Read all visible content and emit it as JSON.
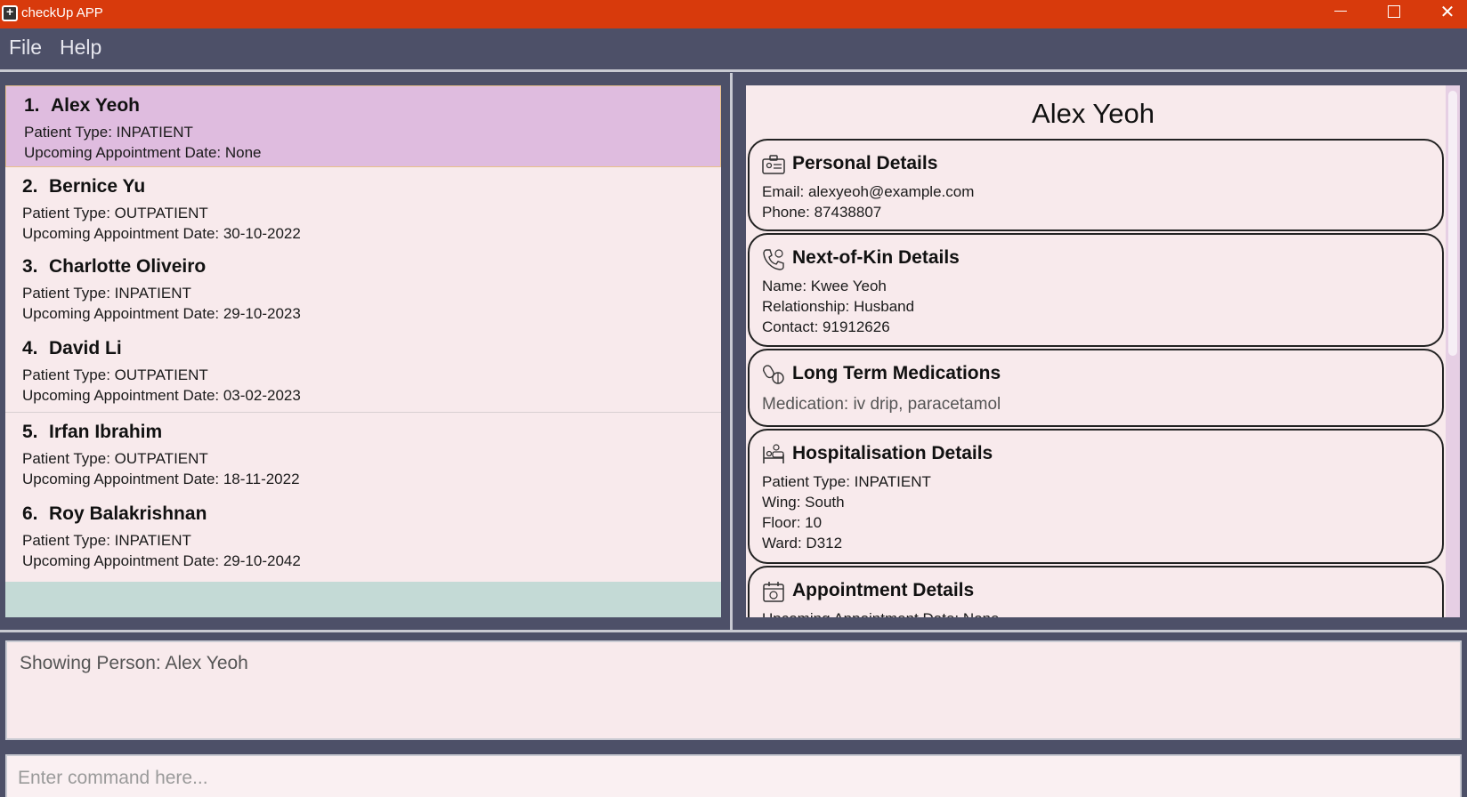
{
  "window": {
    "title": "checkUp APP",
    "minimize_icon": "minimize-icon",
    "maximize_icon": "maximize-icon",
    "close_icon": "close-icon",
    "close_glyph": "✕"
  },
  "menu": {
    "file": "File",
    "help": "Help"
  },
  "patients": [
    {
      "index": "1.",
      "name": "Alex Yeoh",
      "type": "Patient Type: INPATIENT",
      "appointment": "Upcoming Appointment Date: None"
    },
    {
      "index": "2.",
      "name": "Bernice Yu",
      "type": "Patient Type: OUTPATIENT",
      "appointment": "Upcoming Appointment Date: 30-10-2022"
    },
    {
      "index": "3.",
      "name": "Charlotte Oliveiro",
      "type": "Patient Type: INPATIENT",
      "appointment": "Upcoming Appointment Date: 29-10-2023"
    },
    {
      "index": "4.",
      "name": "David Li",
      "type": "Patient Type: OUTPATIENT",
      "appointment": "Upcoming Appointment Date: 03-02-2023"
    },
    {
      "index": "5.",
      "name": "Irfan Ibrahim",
      "type": "Patient Type: OUTPATIENT",
      "appointment": "Upcoming Appointment Date: 18-11-2022"
    },
    {
      "index": "6.",
      "name": "Roy Balakrishnan",
      "type": "Patient Type: INPATIENT",
      "appointment": "Upcoming Appointment Date: 29-10-2042"
    }
  ],
  "detail": {
    "name": "Alex Yeoh",
    "personal": {
      "title": "Personal Details",
      "email": "Email: alexyeoh@example.com",
      "phone": "Phone: 87438807"
    },
    "next_of_kin": {
      "title": "Next-of-Kin Details",
      "name": "Name: Kwee Yeoh",
      "relationship": "Relationship: Husband",
      "contact": "Contact: 91912626"
    },
    "medications": {
      "title": "Long Term Medications",
      "medication": "Medication: iv drip, paracetamol"
    },
    "hospitalisation": {
      "title": "Hospitalisation Details",
      "type": "Patient Type: INPATIENT",
      "wing": "Wing: South",
      "floor": "Floor: 10",
      "ward": "Ward: D312"
    },
    "appointment": {
      "title": "Appointment Details",
      "date": "Upcoming Appointment Date: None"
    }
  },
  "result": {
    "text": "Showing Person: Alex Yeoh"
  },
  "command": {
    "placeholder": "Enter command here..."
  },
  "colors": {
    "titlebar": "#d83a0c",
    "background": "#4d5068",
    "panel": "#f8eaec",
    "selected": "#dfbcdf"
  }
}
